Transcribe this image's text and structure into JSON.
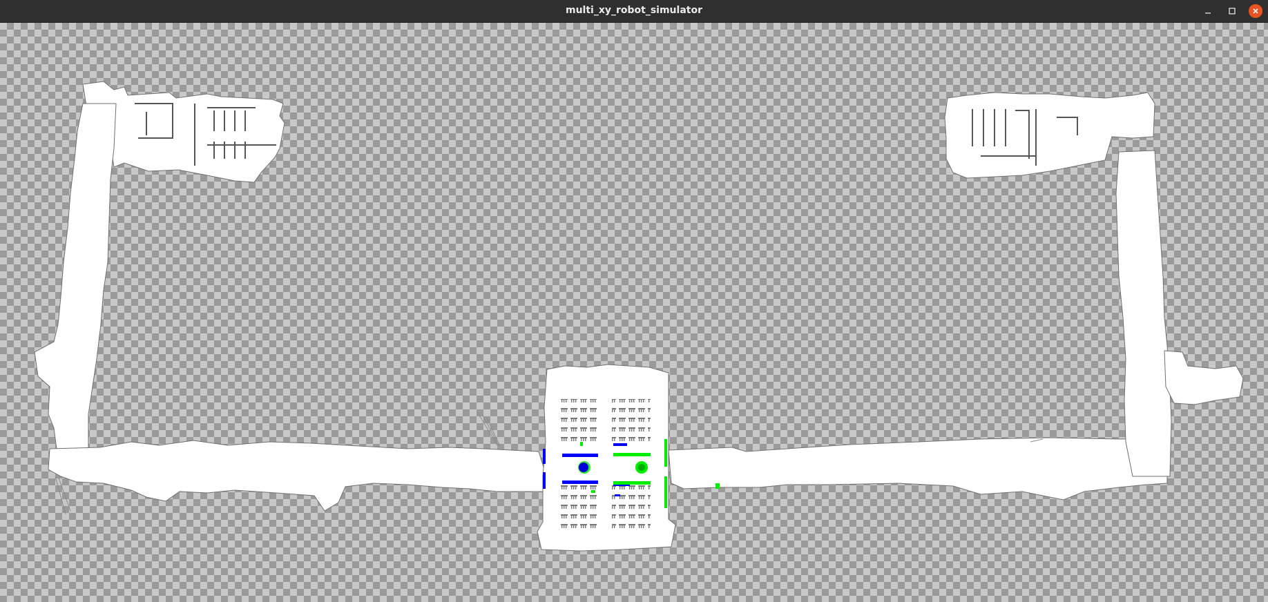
{
  "window": {
    "title": "multi_xy_robot_simulator",
    "controls": [
      "minimize",
      "maximize",
      "close"
    ],
    "close_color": "#e95420"
  },
  "map": {
    "type": "occupancy-grid",
    "background": "transparent-checkerboard",
    "free_space_color": "#ffffff",
    "robots": [
      {
        "name": "robot-blue",
        "color": "#0000ff"
      },
      {
        "name": "robot-green",
        "color": "#00ff00"
      }
    ]
  }
}
